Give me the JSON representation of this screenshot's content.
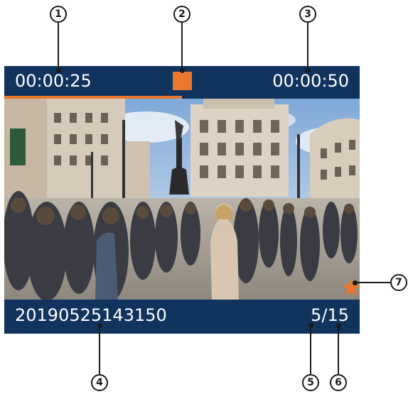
{
  "player": {
    "elapsed_time": "00:00:25",
    "total_time": "00:00:50",
    "progress": 0.5,
    "record_indicator_color": "#e9772d",
    "file_name": "20190525143150",
    "current_index": "5",
    "separator": "/",
    "total_count": "15",
    "favorite_icon": "star-icon",
    "favorite_color": "#e9772d",
    "bar_color": "#10345e"
  },
  "callouts": [
    "1",
    "2",
    "3",
    "4",
    "5",
    "6",
    "7"
  ]
}
